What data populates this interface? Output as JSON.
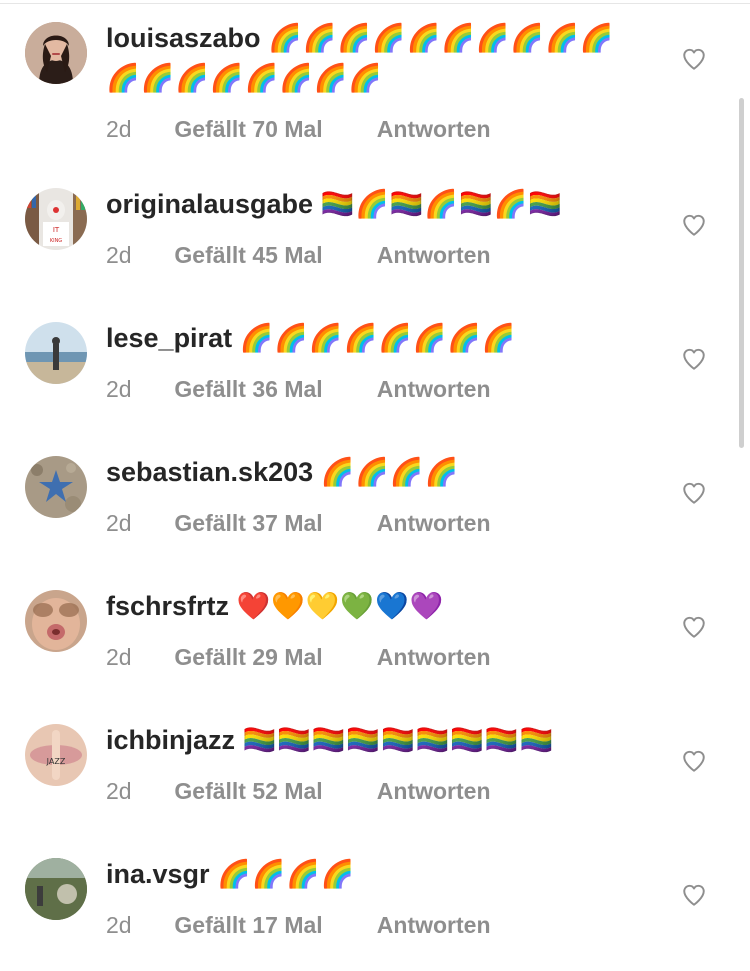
{
  "comments": [
    {
      "username": "louisaszabo",
      "text": "🌈🌈🌈🌈🌈🌈🌈🌈🌈🌈🌈🌈🌈🌈🌈🌈🌈🌈",
      "time": "2d",
      "likes": "Gefällt 70 Mal",
      "reply": "Antworten"
    },
    {
      "username": "originalausgabe",
      "text": "🏳️‍🌈🌈🏳️‍🌈🌈🏳️‍🌈🌈🏳️‍🌈",
      "time": "2d",
      "likes": "Gefällt 45 Mal",
      "reply": "Antworten"
    },
    {
      "username": "lese_pirat",
      "text": "🌈🌈🌈🌈🌈🌈🌈🌈",
      "time": "2d",
      "likes": "Gefällt 36 Mal",
      "reply": "Antworten"
    },
    {
      "username": "sebastian.sk203",
      "text": "🌈🌈🌈🌈",
      "time": "2d",
      "likes": "Gefällt 37 Mal",
      "reply": "Antworten"
    },
    {
      "username": "fschrsfrtz",
      "text": "❤️🧡💛💚💙💜",
      "time": "2d",
      "likes": "Gefällt 29 Mal",
      "reply": "Antworten"
    },
    {
      "username": "ichbinjazz",
      "text": "🏳️‍🌈🏳️‍🌈🏳️‍🌈🏳️‍🌈🏳️‍🌈🏳️‍🌈🏳️‍🌈🏳️‍🌈🏳️‍🌈",
      "time": "2d",
      "likes": "Gefällt 52 Mal",
      "reply": "Antworten"
    },
    {
      "username": "ina.vsgr",
      "text": "🌈🌈🌈🌈",
      "time": "2d",
      "likes": "Gefällt 17 Mal",
      "reply": "Antworten"
    }
  ],
  "colors": {
    "text": "#262626",
    "meta": "#8e8e8e",
    "heart_stroke": "#8e8e8e"
  },
  "icons": {
    "like": "heart-outline-icon"
  }
}
